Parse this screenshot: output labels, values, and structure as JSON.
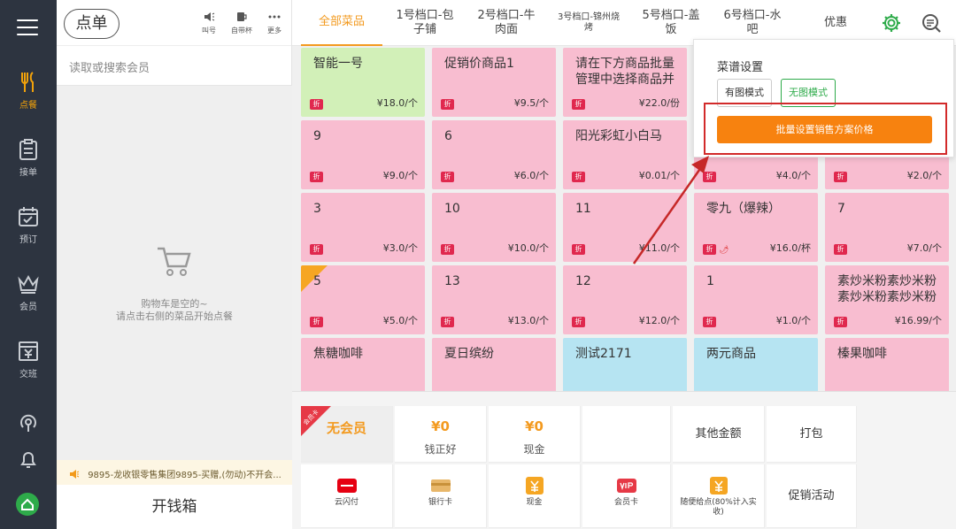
{
  "nav": {
    "items": [
      {
        "label": "点餐",
        "icon": "fork-knife-icon"
      },
      {
        "label": "接单",
        "icon": "clipboard-icon"
      },
      {
        "label": "预订",
        "icon": "calendar-check-icon"
      },
      {
        "label": "会员",
        "icon": "crown-icon"
      },
      {
        "label": "交班",
        "icon": "cash-box-icon"
      }
    ],
    "accent": "#f2a20a"
  },
  "cart": {
    "order_label": "点单",
    "call_label": "叫号",
    "cup_label": "自带杯",
    "more_label": "更多",
    "member_placeholder": "读取或搜索会员",
    "empty_line1": "购物车是空的~",
    "empty_line2": "请点击右侧的菜品开始点餐",
    "marquee": "9895-龙收银零售集团9895-买赠,(勿动)不开会...",
    "cash_drawer": "开钱箱"
  },
  "tabs": {
    "items": [
      {
        "label": "全部菜品"
      },
      {
        "label1": "1号档口-包",
        "label2": "子铺"
      },
      {
        "label1": "2号档口-牛",
        "label2": "肉面"
      },
      {
        "label1": "3号档口-锦州烧",
        "label2": "烤"
      },
      {
        "label1": "5号档口-盖",
        "label2": "饭"
      },
      {
        "label1": "6号档口-水",
        "label2": "吧"
      },
      {
        "label": "优惠"
      }
    ],
    "accent": "#f39a1f"
  },
  "discount_tag": "折",
  "products": [
    {
      "name": "智能一号",
      "price": "¥18.0/个"
    },
    {
      "name": "促销价商品1",
      "price": "¥9.5/个"
    },
    {
      "name": "请在下方商品批量管理中选择商品并",
      "price": "¥22.0/份"
    },
    {
      "name": "9",
      "price": "¥9.0/个"
    },
    {
      "name": "6",
      "price": "¥6.0/个"
    },
    {
      "name": "阳光彩虹小白马",
      "price": "¥0.01/个"
    },
    {
      "name": "",
      "price": "¥4.0/个"
    },
    {
      "name": "",
      "price": "¥2.0/个"
    },
    {
      "name": "3",
      "price": "¥3.0/个"
    },
    {
      "name": "10",
      "price": "¥10.0/个"
    },
    {
      "name": "11",
      "price": "¥11.0/个"
    },
    {
      "name": "零九（爆辣）",
      "price": "¥16.0/杯"
    },
    {
      "name": "7",
      "price": "¥7.0/个"
    },
    {
      "name": "5",
      "price": "¥5.0/个"
    },
    {
      "name": "13",
      "price": "¥13.0/个"
    },
    {
      "name": "12",
      "price": "¥12.0/个"
    },
    {
      "name": "1",
      "price": "¥1.0/个"
    },
    {
      "name": "素炒米粉素炒米粉素炒米粉素炒米粉",
      "price": "¥16.99/个"
    },
    {
      "name": "焦糖咖啡"
    },
    {
      "name": "夏日缤纷"
    },
    {
      "name": "测试2171"
    },
    {
      "name": "两元商品"
    },
    {
      "name": "榛果咖啡"
    }
  ],
  "popover": {
    "title": "菜谱设置",
    "mode_image": "有图模式",
    "mode_noimage": "无图模式",
    "batch_button": "批量设置销售方案价格"
  },
  "payment": {
    "member": "无会员",
    "member_tag": "会员卡",
    "change_amount": "¥0",
    "change_label": "钱正好",
    "cash_amount": "¥0",
    "cash_label": "现金",
    "other_amount": "其他金额",
    "pack": "打包",
    "methods": [
      {
        "label": "云闪付"
      },
      {
        "label": "银行卡"
      },
      {
        "label": "现金"
      },
      {
        "label": "会员卡"
      },
      {
        "label": "随便给点(80%计入实收)"
      }
    ],
    "promo": "促销活动",
    "accent": "#f39a1f"
  }
}
